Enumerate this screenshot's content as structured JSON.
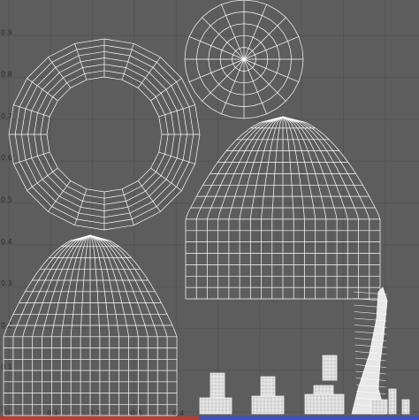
{
  "viewport": {
    "title": "",
    "background": "#5d5d5d",
    "grid_color": "#545454",
    "wire_color": "#ffffff",
    "y_ticks": [
      "0.9",
      "0.8",
      "0.7",
      "0.6",
      "0.5",
      "0.4",
      "0.3",
      "0.2",
      "0.1",
      "0"
    ],
    "x_ticks": [
      "0",
      "0.1",
      "0.2",
      "0.3",
      "0.4"
    ],
    "bottom_axis_colors": [
      "#c0392b",
      "#3b4fd1"
    ]
  },
  "uv_islands": [
    {
      "name": "ring",
      "shape": "annulus"
    },
    {
      "name": "small-disc",
      "shape": "disc"
    },
    {
      "name": "upper-dome",
      "shape": "dome"
    },
    {
      "name": "lower-dome",
      "shape": "dome"
    },
    {
      "name": "blade",
      "shape": "spike"
    },
    {
      "name": "small-pieces",
      "shape": "fragments"
    }
  ]
}
